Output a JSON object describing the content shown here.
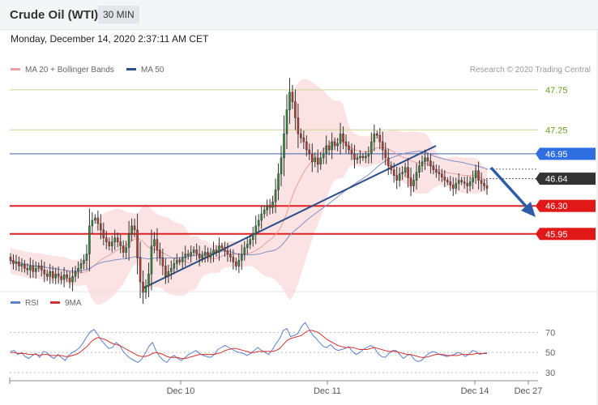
{
  "header": {
    "title": "Crude Oil (WTI)",
    "timeframe": "30 MIN",
    "datetime": "Monday, December 14, 2020 2:37:11 AM CET"
  },
  "legend": {
    "ma20_label": "MA 20 + Bollinger Bands",
    "ma50_label": "MA 50",
    "rsi_label": "RSI",
    "ma9_label": "9MA",
    "credit": "Research © 2020 Trading Central"
  },
  "colors": {
    "bull": "#2e8b3a",
    "bear": "#c0392b",
    "band": "#fbd9d9",
    "ma20": "#e8a0a0",
    "ma50": "#2c4f8a",
    "support": "#e02020",
    "resistance_line": "#2c4f8a",
    "target_line": "#c8d68e",
    "rsi": "#5b7fcf",
    "rsi_ma": "#d63030",
    "arrow": "#2c5da8"
  },
  "chart_data": [
    {
      "type": "candlestick",
      "title": "Crude Oil (WTI)",
      "interval": "30 MIN",
      "ylim": [
        45.25,
        47.9
      ],
      "x_ticks": [
        "Dec 10",
        "Dec 11",
        "Dec 14",
        "Dec 27"
      ],
      "levels": [
        {
          "label": "47.75",
          "value": 47.75,
          "kind": "target"
        },
        {
          "label": "47.25",
          "value": 47.25,
          "kind": "target"
        },
        {
          "label": "46.95",
          "value": 46.95,
          "kind": "resistance"
        },
        {
          "label": "46.64",
          "value": 46.64,
          "kind": "last"
        },
        {
          "label": "46.30",
          "value": 46.3,
          "kind": "support"
        },
        {
          "label": "45.95",
          "value": 45.95,
          "kind": "support"
        }
      ],
      "closes": [
        45.62,
        45.58,
        45.6,
        45.55,
        45.57,
        45.52,
        45.5,
        45.55,
        45.48,
        45.52,
        45.55,
        45.5,
        45.45,
        45.42,
        45.48,
        45.4,
        45.45,
        45.42,
        45.38,
        45.44,
        45.4,
        45.35,
        45.42,
        45.48,
        45.52,
        45.58,
        45.62,
        45.7,
        46.05,
        46.12,
        46.15,
        46.08,
        46.0,
        45.9,
        45.85,
        45.8,
        45.85,
        45.9,
        45.85,
        45.8,
        45.72,
        45.78,
        45.95,
        46.05,
        46.0,
        45.65,
        45.35,
        45.22,
        45.3,
        45.45,
        45.8,
        45.88,
        45.75,
        45.65,
        45.55,
        45.42,
        45.48,
        45.52,
        45.58,
        45.62,
        45.6,
        45.65,
        45.7,
        45.68,
        45.72,
        45.75,
        45.7,
        45.65,
        45.68,
        45.72,
        45.66,
        45.7,
        45.75,
        45.72,
        45.8,
        45.78,
        45.74,
        45.7,
        45.66,
        45.6,
        45.55,
        45.62,
        45.7,
        45.78,
        45.82,
        45.88,
        45.95,
        46.05,
        46.12,
        46.2,
        46.25,
        46.3,
        46.28,
        46.35,
        46.5,
        46.7,
        46.9,
        47.2,
        47.5,
        47.72,
        47.6,
        47.4,
        47.2,
        47.15,
        47.1,
        47.0,
        46.95,
        46.85,
        46.9,
        46.82,
        46.9,
        46.95,
        47.05,
        47.0,
        47.1,
        47.05,
        47.08,
        47.2,
        47.1,
        47.05,
        47.0,
        46.95,
        46.88,
        46.9,
        46.92,
        46.9,
        46.92,
        46.95,
        47.1,
        47.2,
        47.18,
        47.1,
        47.0,
        46.9,
        46.8,
        46.75,
        46.68,
        46.62,
        46.7,
        46.72,
        46.78,
        46.65,
        46.55,
        46.62,
        46.72,
        46.8,
        46.85,
        46.9,
        46.86,
        46.8,
        46.75,
        46.72,
        46.7,
        46.66,
        46.62,
        46.6,
        46.56,
        46.52,
        46.58,
        46.62,
        46.6,
        46.58,
        46.55,
        46.6,
        46.65,
        46.74,
        46.62,
        46.58,
        46.55,
        46.52
      ]
    },
    {
      "type": "line",
      "title": "RSI",
      "ylim": [
        25,
        85
      ],
      "y_ticks": [
        70,
        50,
        30
      ],
      "series": [
        {
          "name": "RSI",
          "values": [
            51,
            52,
            48,
            50,
            46,
            44,
            47,
            49,
            45,
            51,
            50,
            46,
            44,
            48,
            45,
            42,
            47,
            50,
            52,
            55,
            60,
            66,
            71,
            73,
            68,
            62,
            58,
            54,
            55,
            60,
            57,
            51,
            47,
            44,
            42,
            40,
            43,
            49,
            56,
            60,
            52,
            46,
            42,
            40,
            45,
            47,
            44,
            42,
            45,
            48,
            50,
            52,
            49,
            47,
            46,
            45,
            48,
            53,
            55,
            57,
            55,
            53,
            51,
            50,
            49,
            47,
            49,
            52,
            55,
            52,
            50,
            48,
            53,
            59,
            64,
            72,
            74,
            66,
            67,
            69,
            76,
            80,
            74,
            68,
            64,
            60,
            56,
            55,
            58,
            54,
            52,
            53,
            54,
            56,
            51,
            48,
            50,
            53,
            55,
            57,
            55,
            49,
            46,
            45,
            49,
            52,
            52,
            48,
            44,
            47,
            48,
            43,
            41,
            42,
            46,
            49,
            51,
            50,
            48,
            47,
            46,
            47,
            48,
            50,
            49,
            46,
            48,
            52,
            51,
            48,
            49,
            50
          ]
        },
        {
          "name": "9MA",
          "values": [
            50,
            50,
            49,
            49,
            49,
            48,
            48,
            48,
            47,
            48,
            48,
            47,
            47,
            47,
            47,
            46,
            46,
            47,
            48,
            50,
            53,
            56,
            60,
            63,
            65,
            64,
            63,
            61,
            59,
            58,
            57,
            55,
            53,
            51,
            49,
            47,
            46,
            46,
            47,
            49,
            50,
            49,
            48,
            46,
            45,
            45,
            45,
            44,
            44,
            45,
            46,
            47,
            48,
            48,
            48,
            48,
            48,
            49,
            50,
            52,
            53,
            54,
            54,
            53,
            52,
            51,
            50,
            50,
            51,
            51,
            51,
            51,
            51,
            52,
            54,
            58,
            62,
            64,
            65,
            66,
            67,
            70,
            72,
            72,
            71,
            69,
            66,
            63,
            61,
            59,
            57,
            56,
            55,
            55,
            55,
            54,
            53,
            53,
            53,
            54,
            55,
            54,
            53,
            52,
            51,
            51,
            51,
            50,
            49,
            48,
            48,
            47,
            46,
            45,
            45,
            46,
            47,
            48,
            48,
            48,
            47,
            47,
            47,
            47,
            48,
            48,
            48,
            48,
            49,
            49,
            49,
            49
          ]
        }
      ]
    }
  ]
}
